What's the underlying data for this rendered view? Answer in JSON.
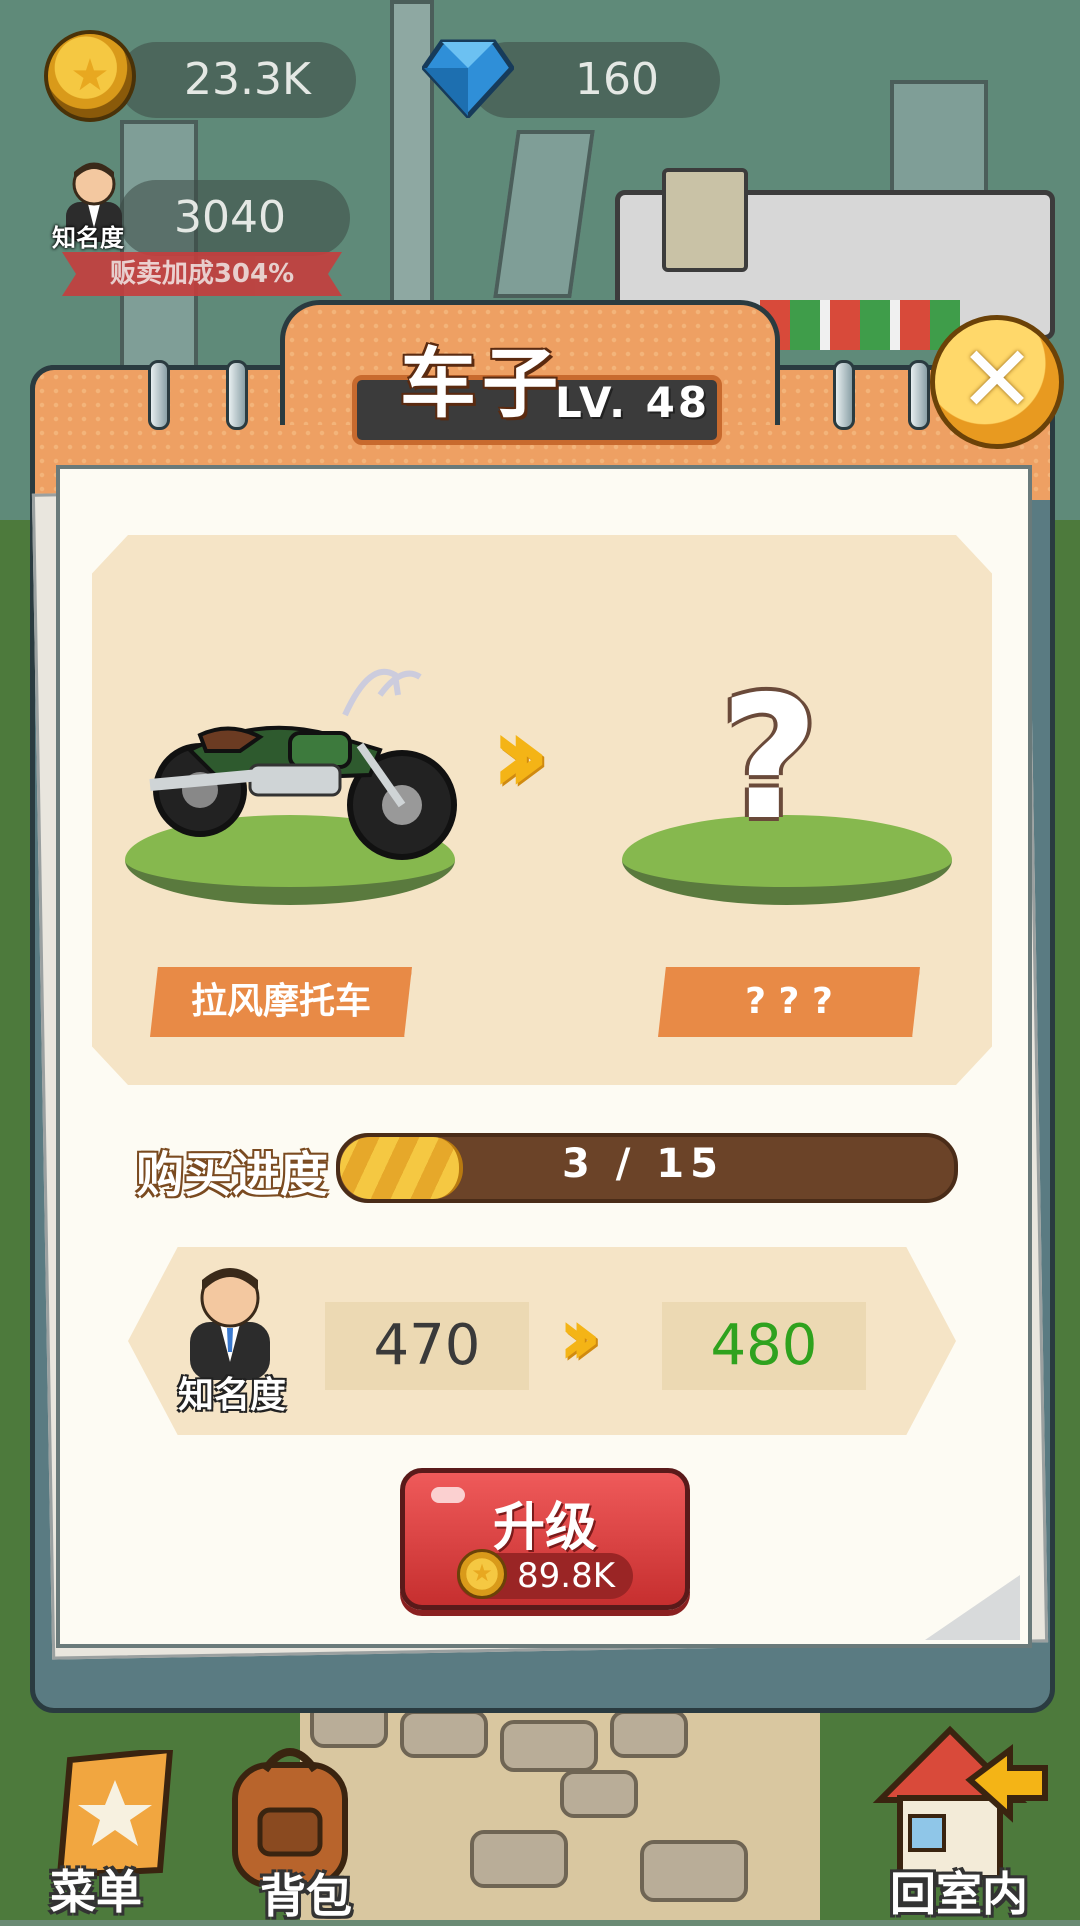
{
  "hud": {
    "coins": "23.3K",
    "gems": "160",
    "fame_value": "3040",
    "fame_tag": "知名度",
    "bonus": "贩卖加成304%"
  },
  "dialog": {
    "title": "车子",
    "level": "LV. 48",
    "current_item": "拉风摩托车",
    "next_item": "? ? ?",
    "next_placeholder": "?",
    "progress_label": "购买进度",
    "progress_text": "3 / 15",
    "progress": {
      "current": 3,
      "total": 15
    },
    "fame_label": "知名度",
    "fame_current": "470",
    "fame_next": "480",
    "upgrade_label": "升级",
    "upgrade_cost": "89.8K"
  },
  "nav": {
    "menu_label": "菜单",
    "bag_label": "背包",
    "home_label": "回室内"
  },
  "colors": {
    "accent_orange": "#eea063",
    "fame_up_green": "#2fa21e",
    "upgrade_red": "#e04545",
    "progress_gold": "#f5c842"
  }
}
